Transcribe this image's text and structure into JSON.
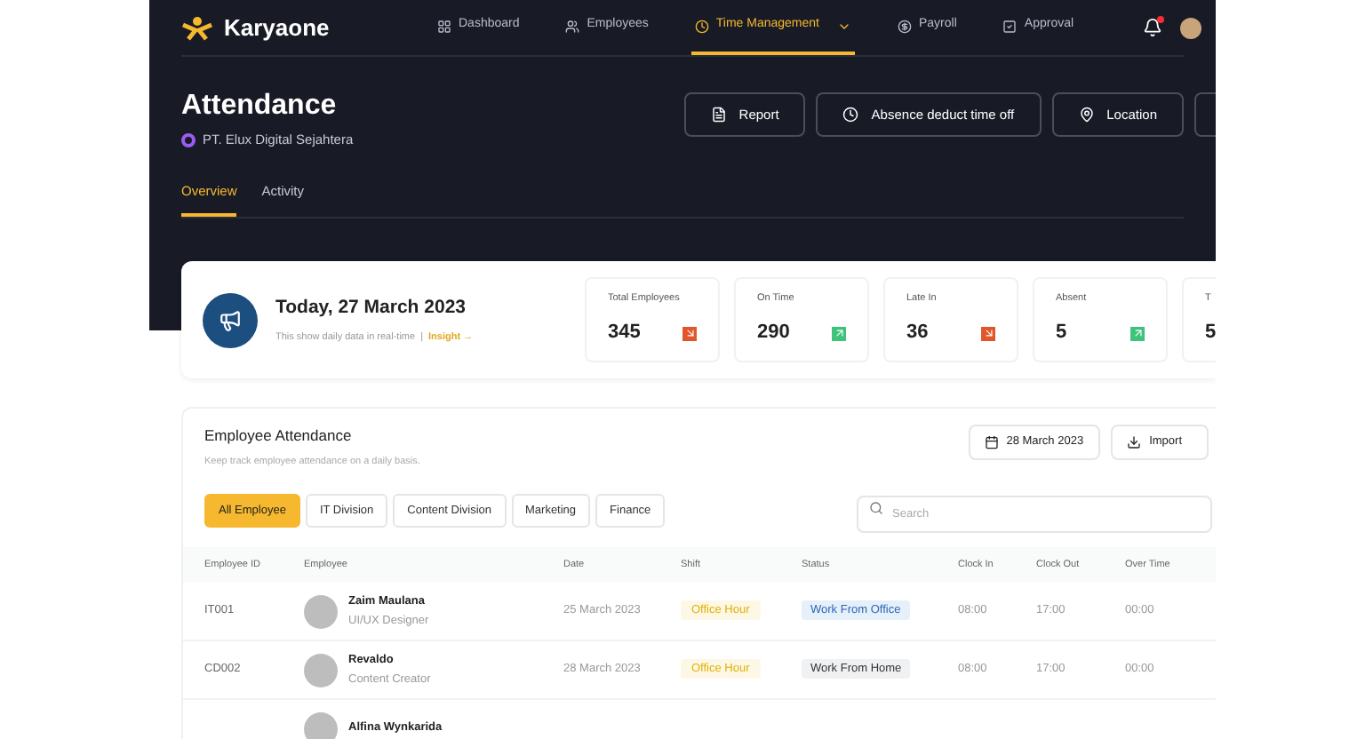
{
  "brand": "Karyaone",
  "nav": [
    {
      "label": "Dashboard",
      "selected": false
    },
    {
      "label": "Employees",
      "selected": false
    },
    {
      "label": "Time Management",
      "selected": true
    },
    {
      "label": "Payroll",
      "selected": false
    },
    {
      "label": "Approval",
      "selected": false
    }
  ],
  "notification": {
    "unread": true
  },
  "page": {
    "title": "Attendance",
    "company": "PT. Elux Digital Sejahtera"
  },
  "actions": [
    {
      "label": "Report"
    },
    {
      "label": "Absence deduct time off"
    },
    {
      "label": "Location"
    }
  ],
  "tabs": [
    {
      "label": "Overview",
      "selected": true
    },
    {
      "label": "Activity",
      "selected": false
    }
  ],
  "today": {
    "title": "Today, 27 March 2023",
    "subtitle": "This show daily data in real-time",
    "separator": "|",
    "link": "Insight →"
  },
  "stats": [
    {
      "label": "Total Employees",
      "value": "345",
      "kind": "down"
    },
    {
      "label": "On Time",
      "value": "290",
      "kind": "up"
    },
    {
      "label": "Late In",
      "value": "36",
      "kind": "down"
    },
    {
      "label": "Absent",
      "value": "5",
      "kind": "up"
    },
    {
      "label": "T",
      "value": "5"
    }
  ],
  "attendance": {
    "title": "Employee Attendance",
    "subtitle": "Keep track employee attendance on a daily basis.",
    "date": "28 March 2023",
    "import": "Import",
    "filters": [
      {
        "label": "All Employee",
        "selected": true
      },
      {
        "label": "IT Division",
        "selected": false
      },
      {
        "label": "Content Division",
        "selected": false
      },
      {
        "label": "Marketing",
        "selected": false
      },
      {
        "label": "Finance",
        "selected": false
      }
    ],
    "search": {
      "placeholder": "Search"
    },
    "columns": [
      "Employee ID",
      "Employee",
      "Date",
      "Shift",
      "Status",
      "Clock In",
      "Clock Out",
      "Over Time"
    ],
    "rows": [
      {
        "id": "IT001",
        "name": "Zaim Maulana",
        "role": "UI/UX Designer",
        "date": "25 March 2023",
        "shift": "Office Hour",
        "status": "Work From Office",
        "kind": "office",
        "clock_in": "08:00",
        "clock_out": "17:00",
        "overtime": "00:00"
      },
      {
        "id": "CD002",
        "name": "Revaldo",
        "role": "Content Creator",
        "date": "28 March 2023",
        "shift": "Office Hour",
        "status": "Work From Home",
        "kind": "home",
        "clock_in": "08:00",
        "clock_out": "17:00",
        "overtime": "00:00"
      },
      {
        "name": "Alfina Wynkarida"
      }
    ]
  }
}
